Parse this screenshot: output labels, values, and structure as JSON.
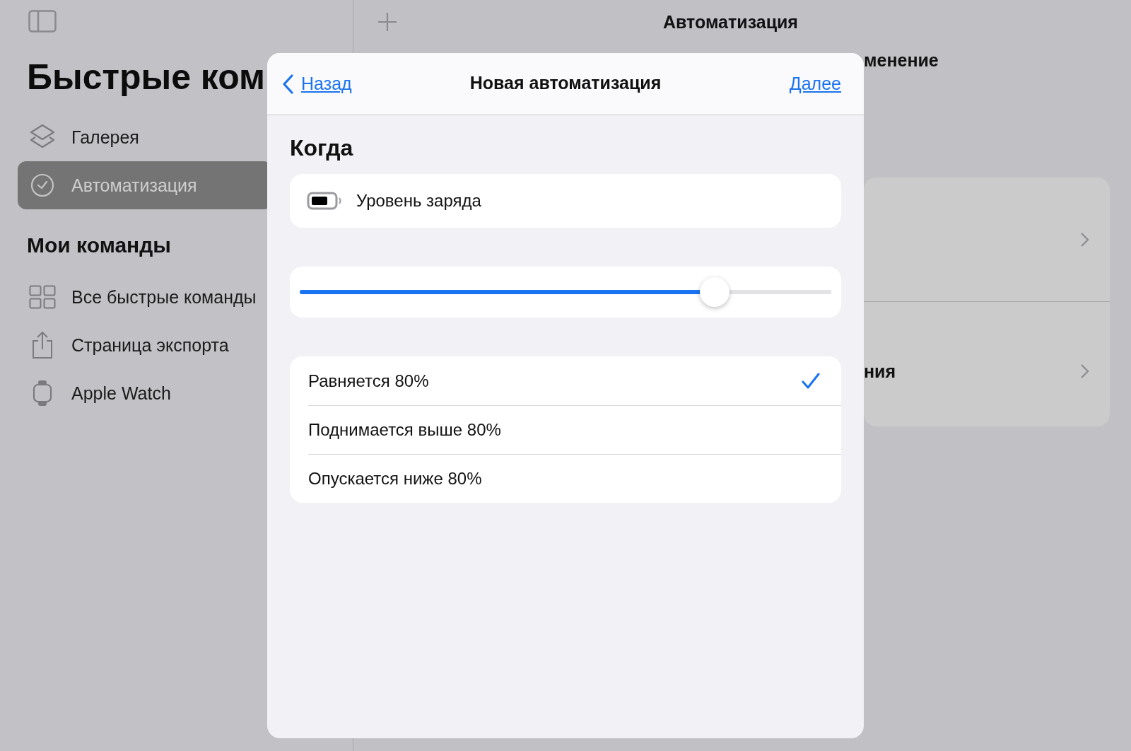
{
  "sidebar": {
    "title": "Быстрые ком",
    "items": [
      {
        "label": "Галерея",
        "selected": false
      },
      {
        "label": "Автоматизация",
        "selected": true
      }
    ],
    "section_title": "Мои команды",
    "section_items": [
      {
        "label": "Все быстрые команды"
      },
      {
        "label": "Страница экспорта"
      },
      {
        "label": "Apple Watch"
      }
    ]
  },
  "main": {
    "title": "Автоматизация",
    "subtitle_fragment": "менение",
    "row_fragment": "ния"
  },
  "modal": {
    "back": "Назад",
    "title": "Новая автоматизация",
    "next": "Далее",
    "section": "Когда",
    "trigger": "Уровень заряда",
    "slider": {
      "level": 0.78
    },
    "options": [
      {
        "label": "Равняется 80%",
        "selected": true
      },
      {
        "label": "Поднимается выше 80%",
        "selected": false
      },
      {
        "label": "Опускается ниже 80%",
        "selected": false
      }
    ]
  }
}
